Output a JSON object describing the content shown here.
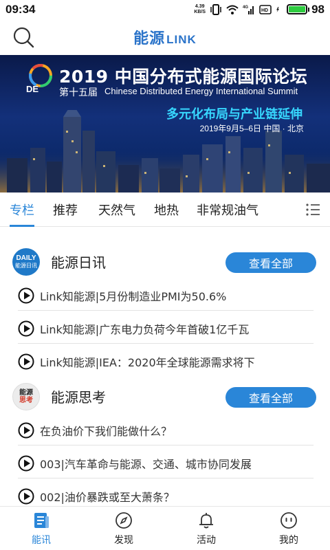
{
  "status_bar": {
    "time": "09:34",
    "net_speed_value": "4.39",
    "net_speed_unit": "KB/S",
    "battery_percent": 98,
    "battery_text": "98"
  },
  "header": {
    "logo_cn": "能源",
    "logo_en": "LINK",
    "search_icon": "search-icon"
  },
  "banner": {
    "logo_text": "DE",
    "title": "2019 中国分布式能源国际论坛",
    "edition": "第十五届",
    "english_title": "Chinese Distributed Energy International Summit",
    "slogan": "多元化布局与产业链延伸",
    "date_location": "2019年9月5–6日   中国 · 北京"
  },
  "tabs": [
    {
      "label": "专栏",
      "active": true
    },
    {
      "label": "推荐",
      "active": false
    },
    {
      "label": "天然气",
      "active": false
    },
    {
      "label": "地热",
      "active": false
    },
    {
      "label": "非常规油气",
      "active": false
    }
  ],
  "sections": [
    {
      "badge_line1": "DAILY",
      "badge_line2": "能源日讯",
      "title": "能源日讯",
      "view_all": "查看全部",
      "items": [
        "Link知能源|5月份制造业PMI为50.6%",
        "Link知能源|广东电力负荷今年首破1亿千瓦",
        "Link知能源|IEA：2020年全球能源需求将下"
      ]
    },
    {
      "badge_line1": "能源",
      "badge_line2": "思考",
      "title": "能源思考",
      "view_all": "查看全部",
      "items": [
        "在负油价下我们能做什么？",
        "003|汽车革命与能源、交通、城市协同发展",
        "002|油价暴跌或至大萧条？"
      ]
    }
  ],
  "bottom_nav": [
    {
      "label": "能讯",
      "icon": "news-icon",
      "active": true
    },
    {
      "label": "发现",
      "icon": "compass-icon",
      "active": false
    },
    {
      "label": "活动",
      "icon": "bell-icon",
      "active": false
    },
    {
      "label": "我的",
      "icon": "profile-face-icon",
      "active": false
    }
  ],
  "colors": {
    "accent": "#2a86d8",
    "logo": "#2a73c9",
    "slogan": "#37d8ff",
    "battery": "#2ecc40"
  }
}
